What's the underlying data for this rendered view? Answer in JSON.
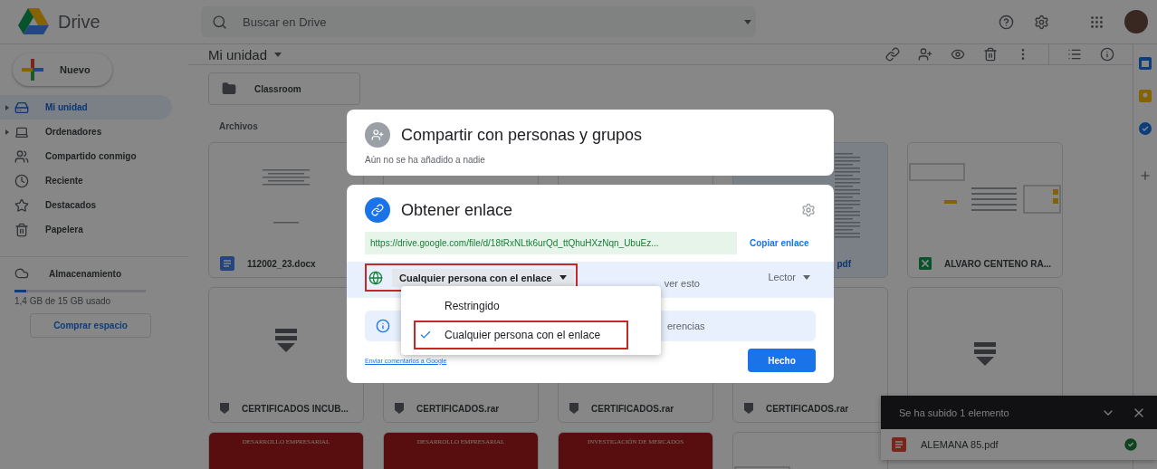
{
  "topbar": {
    "app_name": "Drive",
    "search": {
      "placeholder": "Buscar en Drive"
    }
  },
  "sidebar": {
    "new_button": "Nuevo",
    "items": [
      {
        "label": "Mi unidad",
        "expandable": true,
        "selected": true
      },
      {
        "label": "Ordenadores",
        "expandable": true,
        "selected": false
      },
      {
        "label": "Compartido conmigo",
        "expandable": false,
        "selected": false
      },
      {
        "label": "Reciente",
        "expandable": false,
        "selected": false
      },
      {
        "label": "Destacados",
        "expandable": false,
        "selected": false
      },
      {
        "label": "Papelera",
        "expandable": false,
        "selected": false
      }
    ],
    "storage": {
      "label": "Almacenamiento",
      "level": 0.093,
      "usage": "1,4 GB de 15 GB usado",
      "buy_button": "Comprar espacio"
    }
  },
  "breadcrumb": "Mi unidad",
  "folders": [
    {
      "name": "Classroom"
    }
  ],
  "files_heading": "Archivos",
  "files": [
    {
      "kind": "doc",
      "name": "112002_23.docx",
      "selected": false
    },
    {
      "kind": "covered"
    },
    {
      "kind": "covered"
    },
    {
      "kind": "pdf",
      "name": "pdf",
      "selected": true
    },
    {
      "kind": "xlsx",
      "name": "ALVARO CENTENO RA...",
      "selected": false
    },
    {
      "kind": "archive",
      "name": "CERTIFICADOS INCUB...",
      "selected": false
    },
    {
      "kind": "archive",
      "name": "CERTIFICADOS.rar",
      "selected": false
    },
    {
      "kind": "archive",
      "name": "CERTIFICADOS.rar",
      "selected": false
    },
    {
      "kind": "archive",
      "name": "CERTIFICADOS.rar",
      "selected": false
    },
    {
      "kind": "archive",
      "selected": false
    },
    {
      "kind": "cover",
      "title": "DESARROLLO EMPRESARIAL"
    },
    {
      "kind": "cover",
      "title": "DESARROLLO EMPRESARIAL"
    },
    {
      "kind": "cover",
      "title": "INVESTIGACIÓN DE MERCADOS"
    },
    {
      "kind": "sheet",
      "selected": false
    }
  ],
  "share_dialog": {
    "people": {
      "title": "Compartir con personas y grupos",
      "subtitle": "Aún no se ha añadido a nadie"
    },
    "link": {
      "title": "Obtener enlace",
      "url": "https://drive.google.com/file/d/18tRxNLtk6urQd_ttQhuHXzNqn_UbuEz...",
      "copy_button": "Copiar enlace",
      "access": {
        "value": "Cualquier persona con el enlace",
        "highlighted": true,
        "description": "ver esto",
        "role": "Lector"
      },
      "info": "erencias",
      "feedback_link": "Enviar comentarios a Google",
      "done_button": "Hecho"
    },
    "access_menu": {
      "options": [
        {
          "label": "Restringido",
          "selected": false,
          "highlighted": false
        },
        {
          "label": "Cualquier persona con el enlace",
          "selected": true,
          "highlighted": true
        }
      ]
    }
  },
  "upload_toast": {
    "title": "Se ha subido 1 elemento",
    "items": [
      {
        "name": "ALEMANA 85.pdf",
        "done": true
      }
    ]
  }
}
